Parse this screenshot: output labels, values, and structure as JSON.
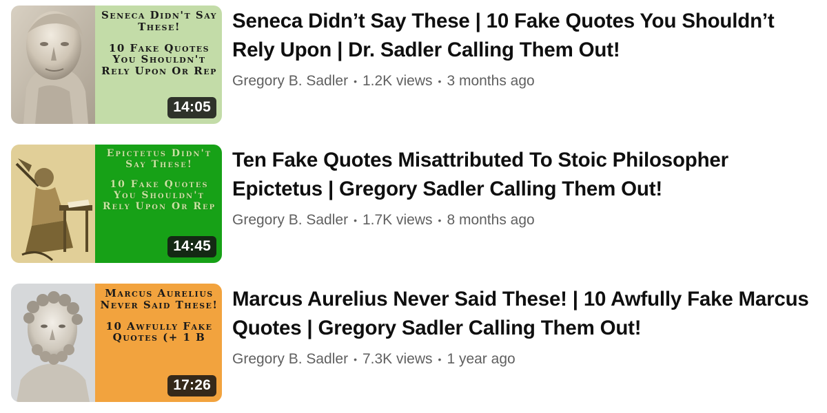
{
  "videos": [
    {
      "thumbnail": {
        "top_text": "Seneca Didn't Say These!",
        "bottom_text": "10 Fake Quotes You Shouldn't Rely Upon Or Rep",
        "duration": "14:05",
        "accent_color": "#c3dca8"
      },
      "title": "Seneca Didn’t Say These | 10 Fake Quotes You Shouldn’t Rely Upon | Dr. Sadler Calling Them Out!",
      "channel": "Gregory B. Sadler",
      "separator": "•",
      "views": "1.2K views",
      "age": "3 months ago"
    },
    {
      "thumbnail": {
        "top_text": "Epictetus Didn't Say These!",
        "bottom_text": "10 Fake Quotes You Shouldn't Rely Upon Or Rep",
        "duration": "14:45",
        "accent_color": "#17a117"
      },
      "title": "Ten Fake Quotes Misattributed To Stoic Philosopher Epictetus | Gregory Sadler Calling Them Out!",
      "channel": "Gregory B. Sadler",
      "separator": "•",
      "views": "1.7K views",
      "age": "8 months ago"
    },
    {
      "thumbnail": {
        "top_text": "Marcus Aurelius Never Said These!",
        "bottom_text": "10 Awfully Fake Quotes (+ 1 B",
        "duration": "17:26",
        "accent_color": "#f2a33e"
      },
      "title": "Marcus Aurelius Never Said These! | 10 Awfully Fake Marcus Quotes | Gregory Sadler Calling Them Out!",
      "channel": "Gregory B. Sadler",
      "separator": "•",
      "views": "7.3K views",
      "age": "1 year ago"
    }
  ]
}
